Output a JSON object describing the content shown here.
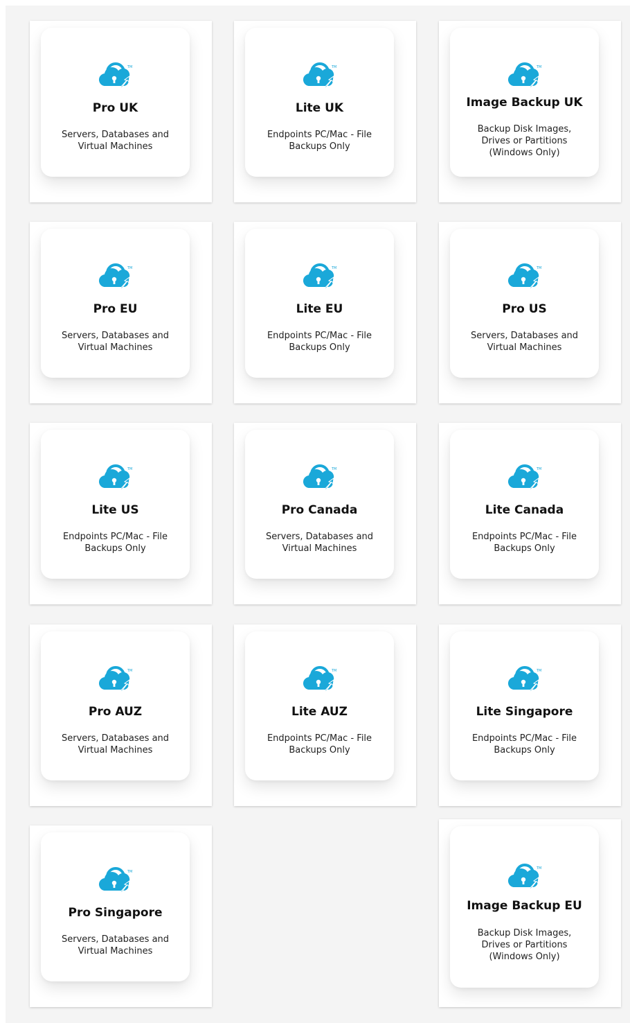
{
  "brand": {
    "accent": "#1aa8d9"
  },
  "products": [
    {
      "title": "Pro UK",
      "description": "Servers, Databases and Virtual Machines",
      "icon": "cloud-lock-icon"
    },
    {
      "title": "Lite UK",
      "description": "Endpoints PC/Mac - File Backups Only",
      "icon": "cloud-lock-icon"
    },
    {
      "title": "Image Backup UK",
      "description": "Backup Disk Images, Drives or Partitions (Windows Only)",
      "icon": "cloud-lock-icon"
    },
    {
      "title": "Pro EU",
      "description": "Servers, Databases and Virtual Machines",
      "icon": "cloud-lock-icon"
    },
    {
      "title": "Lite EU",
      "description": "Endpoints PC/Mac - File Backups Only",
      "icon": "cloud-lock-icon"
    },
    {
      "title": "Pro US",
      "description": "Servers, Databases and Virtual Machines",
      "icon": "cloud-lock-icon"
    },
    {
      "title": "Lite US",
      "description": "Endpoints PC/Mac - File Backups Only",
      "icon": "cloud-lock-icon"
    },
    {
      "title": "Pro Canada",
      "description": "Servers, Databases and Virtual Machines",
      "icon": "cloud-lock-icon"
    },
    {
      "title": "Lite Canada",
      "description": "Endpoints PC/Mac - File Backups Only",
      "icon": "cloud-lock-icon"
    },
    {
      "title": "Pro AUZ",
      "description": "Servers, Databases and Virtual Machines",
      "icon": "cloud-lock-icon"
    },
    {
      "title": "Lite AUZ",
      "description": "Endpoints PC/Mac - File Backups Only",
      "icon": "cloud-lock-icon"
    },
    {
      "title": "Lite Singapore",
      "description": "Endpoints PC/Mac - File Backups Only",
      "icon": "cloud-lock-icon"
    },
    {
      "title": "Pro Singapore",
      "description": "Servers, Databases and Virtual Machines",
      "icon": "cloud-lock-icon"
    },
    {
      "title": "Image Backup EU",
      "description": "Backup Disk Images, Drives or Partitions (Windows Only)",
      "icon": "cloud-lock-icon"
    }
  ]
}
